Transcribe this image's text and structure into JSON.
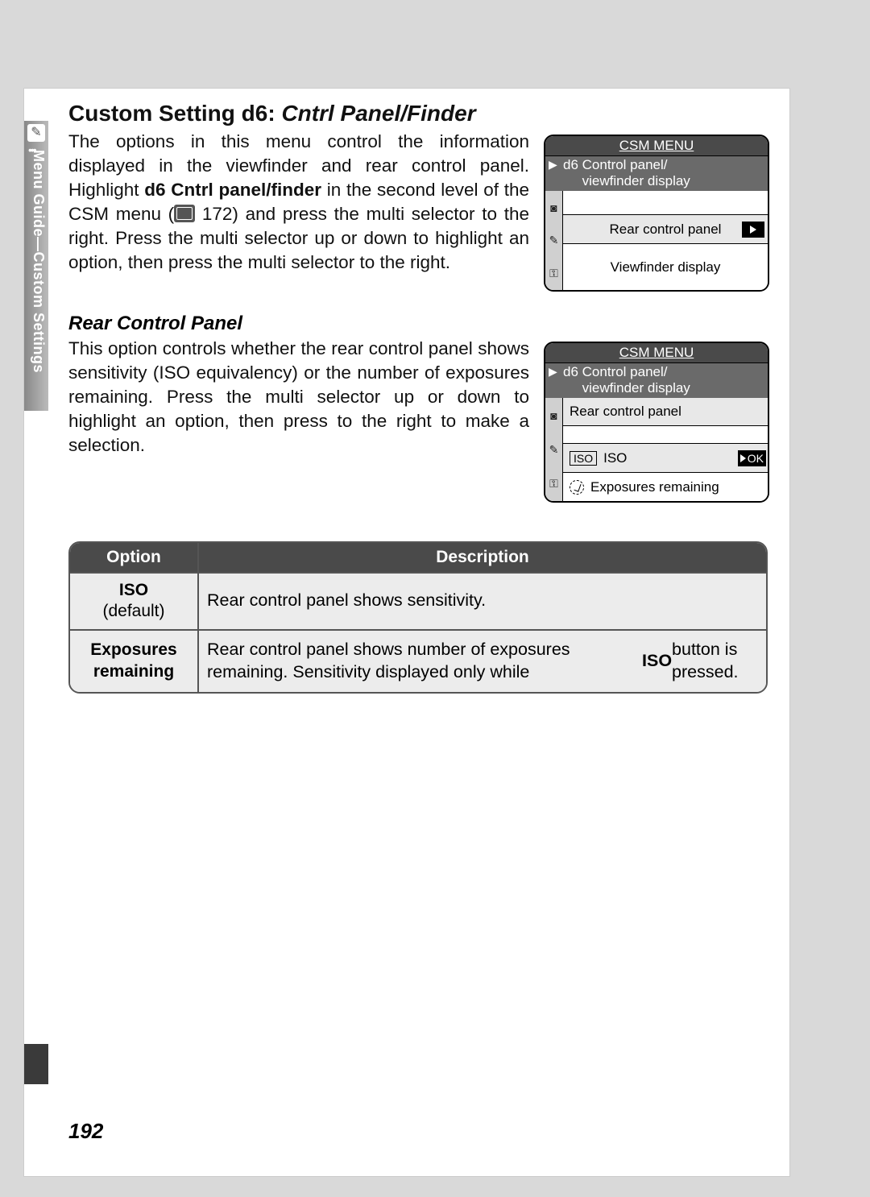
{
  "sidetab": {
    "label": "Menu Guide—Custom Settings"
  },
  "title_plain": "Custom Setting d6: ",
  "title_italic": "Cntrl Panel/Finder",
  "para1_a": "The options in this menu control the information displayed in the viewfinder and rear control panel. Highlight ",
  "para1_bold": "d6 Cntrl panel/finder",
  "para1_b": " in the second level of the CSM menu (",
  "para1_ref": " 172) and press the multi selector to the right.  Press the multi selector up or down to highlight an option, then press the multi selector to the right.",
  "subhead": "Rear Control Panel",
  "para2": "This option controls whether the rear control panel shows sensitivity (ISO equivalency) or the number of exposures remaining.  Press the multi selector up or down to highlight an option, then press to the right to make a selection.",
  "lcd1": {
    "title": "CSM MENU",
    "sub_code": "d6",
    "sub_line1": "Control panel/",
    "sub_line2": "viewfinder display",
    "row1": "Rear control panel",
    "row2": "Viewfinder display"
  },
  "lcd2": {
    "title": "CSM MENU",
    "sub_code": "d6",
    "sub_line1": "Control panel/",
    "sub_line2": "viewfinder display",
    "row_caption": "Rear control panel",
    "iso_box": "ISO",
    "iso_text": "ISO",
    "ok": "OK",
    "exp_text": "Exposures remaining"
  },
  "table": {
    "h1": "Option",
    "h2": "Description",
    "rows": [
      {
        "opt_bold": "ISO",
        "opt_sub": "(default)",
        "desc": "Rear control panel shows sensitivity."
      },
      {
        "opt_bold": "Exposures remaining",
        "opt_sub": "",
        "desc_a": "Rear control panel shows number of exposures remaining.  Sensitivity displayed only while ",
        "desc_bold": "ISO",
        "desc_b": " button is pressed."
      }
    ]
  },
  "page_num": "192"
}
